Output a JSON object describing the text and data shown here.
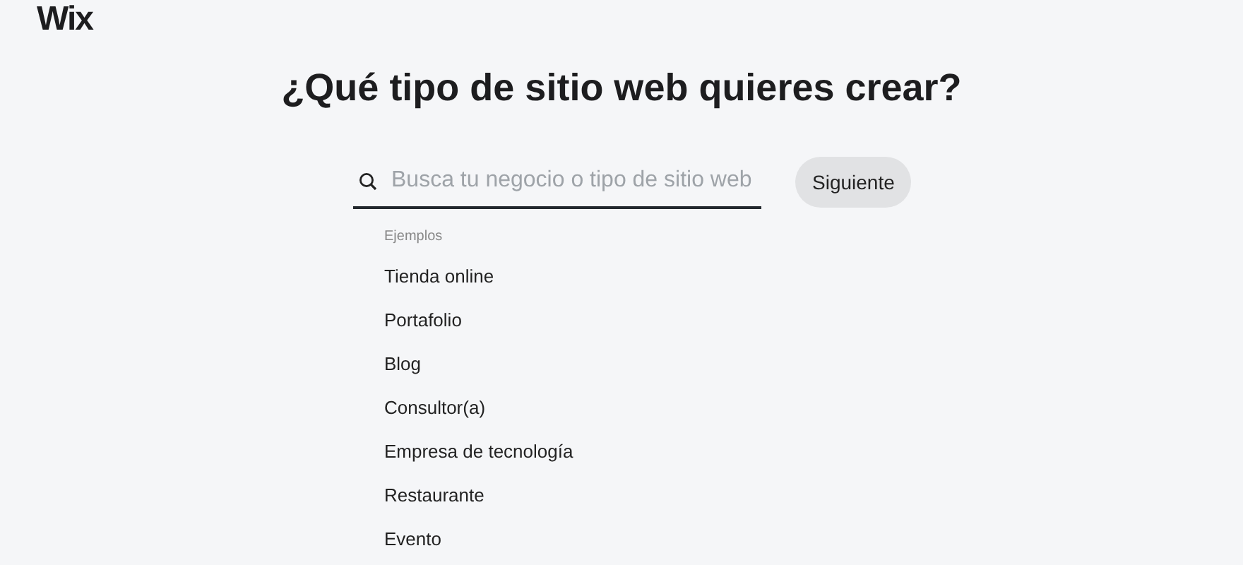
{
  "logo": "Wix",
  "heading": "¿Qué tipo de sitio web quieres crear?",
  "search": {
    "placeholder": "Busca tu negocio o tipo de sitio web"
  },
  "next_button": "Siguiente",
  "examples_label": "Ejemplos",
  "examples": [
    "Tienda online",
    "Portafolio",
    "Blog",
    "Consultor(a)",
    "Empresa de tecnología",
    "Restaurante",
    "Evento"
  ]
}
